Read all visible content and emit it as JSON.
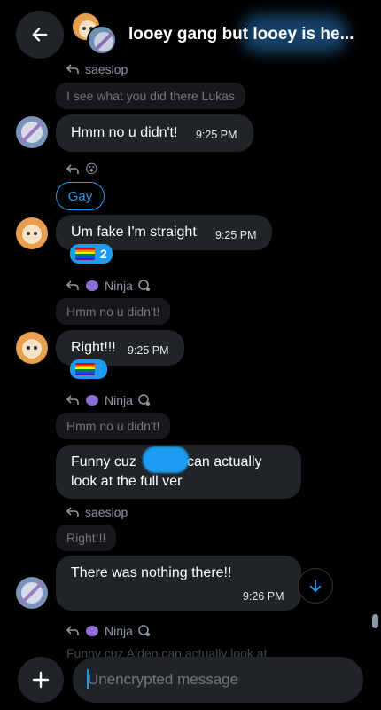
{
  "header": {
    "title": "looey gang but looey is he...",
    "back_icon": "arrow-left-icon",
    "group_avatar": "group-avatar"
  },
  "messages": {
    "m1": {
      "reply_author": "saeslop",
      "quote": "I see what you did there Lukas",
      "text": "Hmm no u didn't!",
      "time": "9:25 PM"
    },
    "m2": {
      "reply_emoji": "😮",
      "text": "Gay"
    },
    "m3": {
      "text": "Um fake I'm straight",
      "time": "9:25 PM",
      "reaction_count": "2"
    },
    "m4": {
      "reply_author": "Ninja",
      "quote": "Hmm no u didn't!",
      "text": "Right!!!",
      "time": "9:25 PM"
    },
    "m5": {
      "reply_author": "Ninja",
      "quote": "Hmm no u didn't!",
      "text_part1": "Funny cuz",
      "text_part2": "can actually",
      "text_line2": "look at the full ver"
    },
    "m6": {
      "reply_author": "saeslop",
      "quote": "Right!!!",
      "text": "There was nothing there!!",
      "time": "9:26 PM"
    },
    "m7": {
      "reply_author": "Ninja",
      "quote_peek": "Funny cuz Aiden can actually look at"
    }
  },
  "composer": {
    "placeholder": "Unencrypted message"
  },
  "colors": {
    "accent": "#1d9bf0",
    "bubble": "#202327",
    "background": "#000000"
  }
}
